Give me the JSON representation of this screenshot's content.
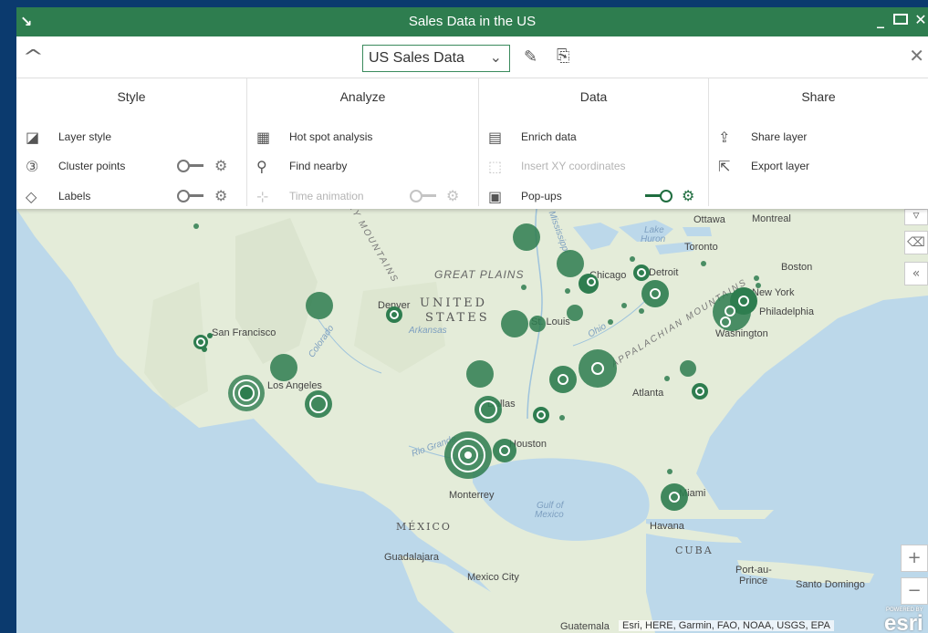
{
  "window": {
    "title": "Sales Data in the US",
    "corner_icon": "arrow-down-right-icon",
    "buttons": [
      "minimize",
      "maximize",
      "close"
    ]
  },
  "layer_bar": {
    "selected_layer": "US Sales Data",
    "icons": [
      "chevron-up-icon",
      "chevron-down-icon",
      "pencil-icon",
      "copy-icon",
      "close-icon"
    ]
  },
  "toolbox": {
    "style": {
      "heading": "Style",
      "items": [
        {
          "label": "Layer style",
          "icon": "layer-style-icon"
        },
        {
          "label": "Cluster points",
          "icon": "cluster-icon",
          "toggle": "off"
        },
        {
          "label": "Labels",
          "icon": "label-tag-icon",
          "toggle": "off"
        }
      ]
    },
    "analyze": {
      "heading": "Analyze",
      "items": [
        {
          "label": "Hot spot analysis",
          "icon": "hotspot-icon"
        },
        {
          "label": "Find nearby",
          "icon": "find-nearby-icon"
        },
        {
          "label": "Time animation",
          "icon": "time-animation-icon",
          "toggle": "off",
          "disabled": true
        }
      ]
    },
    "data": {
      "heading": "Data",
      "items": [
        {
          "label": "Enrich data",
          "icon": "enrich-icon"
        },
        {
          "label": "Insert XY coordinates",
          "icon": "xy-icon",
          "disabled": true
        },
        {
          "label": "Pop-ups",
          "icon": "popup-icon",
          "toggle": "on"
        }
      ]
    },
    "share": {
      "heading": "Share",
      "items": [
        {
          "label": "Share layer",
          "icon": "share-icon"
        },
        {
          "label": "Export layer",
          "icon": "export-icon"
        }
      ]
    }
  },
  "map": {
    "labels": {
      "great_plains": "GREAT PLAINS",
      "united": "UNITED",
      "states": "STATES",
      "mexico": "MÉXICO",
      "cuba": "CUBA",
      "gulf": "Gulf of",
      "gulf2": "Mexico",
      "lake_huron": "Lake",
      "lake_huron2": "Huron",
      "appalachian": "APPALACHIAN MOUNTAINS",
      "rocky": "ROCKY MOUNTAINS",
      "arkansas": "Arkansas",
      "colorado": "Colorado",
      "rio_grande": "Rio Grande",
      "ohio": "Ohio",
      "mississippi": "Mississippi"
    },
    "cities": [
      "Ottawa",
      "Montreal",
      "Toronto",
      "Boston",
      "Detroit",
      "Chicago",
      "New York",
      "Philadelphia",
      "Washington",
      "Denver",
      "San Francisco",
      "Los Angeles",
      "St. Louis",
      "Atlanta",
      "Dallas",
      "Houston",
      "Miami",
      "Monterrey",
      "Havana",
      "Guadalajara",
      "Mexico City",
      "Port-au-",
      "Prince",
      "Santo Domingo",
      "Guatemala"
    ],
    "attribution": "Esri, HERE, Garmin, FAO, NOAA, USGS, EPA",
    "powered_by": "POWERED BY",
    "esri": "esri",
    "zoom_in": "+",
    "zoom_out": "−",
    "side_controls": [
      "expand-icon",
      "erase-icon",
      "collapse-panel-icon"
    ],
    "marker_color": "#2e7d4f"
  }
}
